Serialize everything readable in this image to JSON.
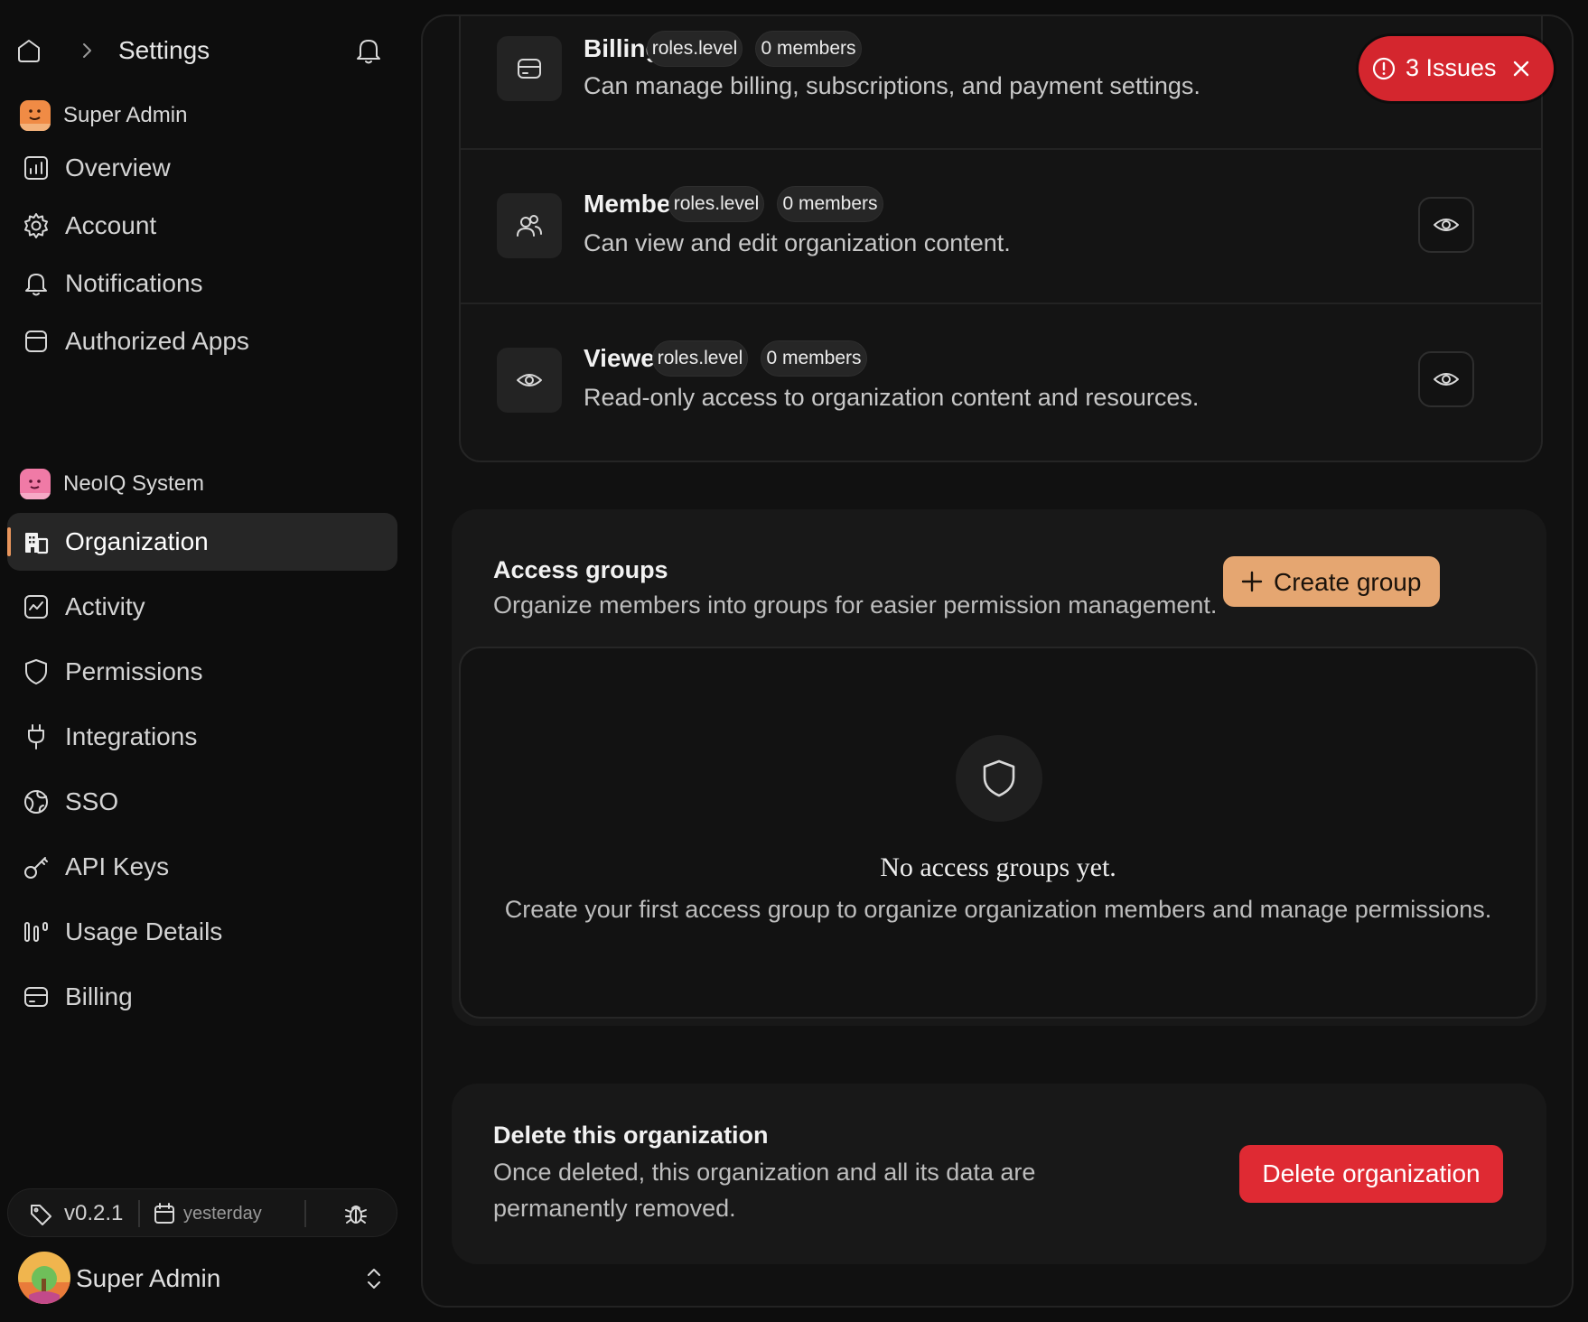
{
  "breadcrumb": {
    "title": "Settings"
  },
  "user_section": {
    "name": "Super Admin",
    "items": [
      {
        "label": "Overview",
        "icon": "chart-icon"
      },
      {
        "label": "Account",
        "icon": "gear-icon"
      },
      {
        "label": "Notifications",
        "icon": "bell-icon"
      },
      {
        "label": "Authorized Apps",
        "icon": "app-window-icon"
      }
    ]
  },
  "org_section": {
    "name": "NeoIQ System",
    "items": [
      {
        "label": "Organization",
        "icon": "building-icon",
        "active": true
      },
      {
        "label": "Activity",
        "icon": "activity-icon"
      },
      {
        "label": "Permissions",
        "icon": "shield-icon"
      },
      {
        "label": "Integrations",
        "icon": "plug-icon"
      },
      {
        "label": "SSO",
        "icon": "globe-icon"
      },
      {
        "label": "API Keys",
        "icon": "key-icon"
      },
      {
        "label": "Usage Details",
        "icon": "usage-bars-icon"
      },
      {
        "label": "Billing",
        "icon": "credit-card-icon"
      }
    ]
  },
  "footer": {
    "version": "v0.2.1",
    "date": "yesterday",
    "user_name": "Super Admin"
  },
  "roles": [
    {
      "title": "Billing",
      "tag": "roles.level",
      "members": "0 members",
      "desc": "Can manage billing, subscriptions, and payment settings.",
      "icon": "credit-card-icon"
    },
    {
      "title": "Member",
      "tag": "roles.level",
      "members": "0 members",
      "desc": "Can view and edit organization content.",
      "icon": "users-icon"
    },
    {
      "title": "Viewer",
      "tag": "roles.level",
      "members": "0 members",
      "desc": "Read-only access to organization content and resources.",
      "icon": "eye-icon"
    }
  ],
  "issues": {
    "label": "3 Issues",
    "color": "#d4262e"
  },
  "access_groups": {
    "title": "Access groups",
    "desc": "Organize members into groups for easier permission management.",
    "button": "Create group",
    "empty_title": "No access groups yet.",
    "empty_desc": "Create your first access group to organize organization members and manage permissions."
  },
  "danger": {
    "title": "Delete this organization",
    "desc_line1": "Once deleted, this organization and all its data are",
    "desc_line2": "permanently removed.",
    "button": "Delete organization",
    "color": "#df2a33"
  },
  "colors": {
    "accent": "#e5a671",
    "active_indicator": "#e8955c",
    "background": "#0d0d0d"
  }
}
